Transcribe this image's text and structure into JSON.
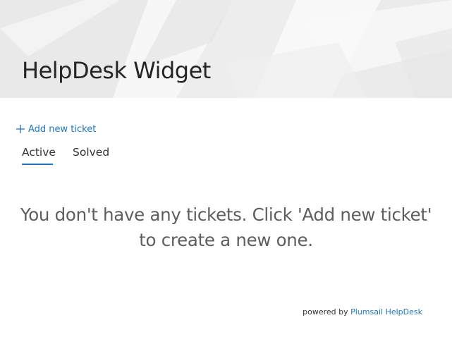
{
  "header": {
    "title": "HelpDesk Widget"
  },
  "actions": {
    "add_ticket_label": "Add new ticket",
    "add_icon": "plus-icon"
  },
  "tabs": [
    {
      "label": "Active",
      "selected": true
    },
    {
      "label": "Solved",
      "selected": false
    }
  ],
  "empty_state": {
    "line1": "You don't have any tickets. Click 'Add new ticket'",
    "line2": "to create a new one."
  },
  "footer": {
    "prefix": "powered by",
    "link_label": "Plumsail HelpDesk"
  },
  "colors": {
    "accent": "#1d77c2",
    "text": "#333333",
    "muted_text": "#5e5e5e",
    "header_bg": "#f3f3f3"
  }
}
